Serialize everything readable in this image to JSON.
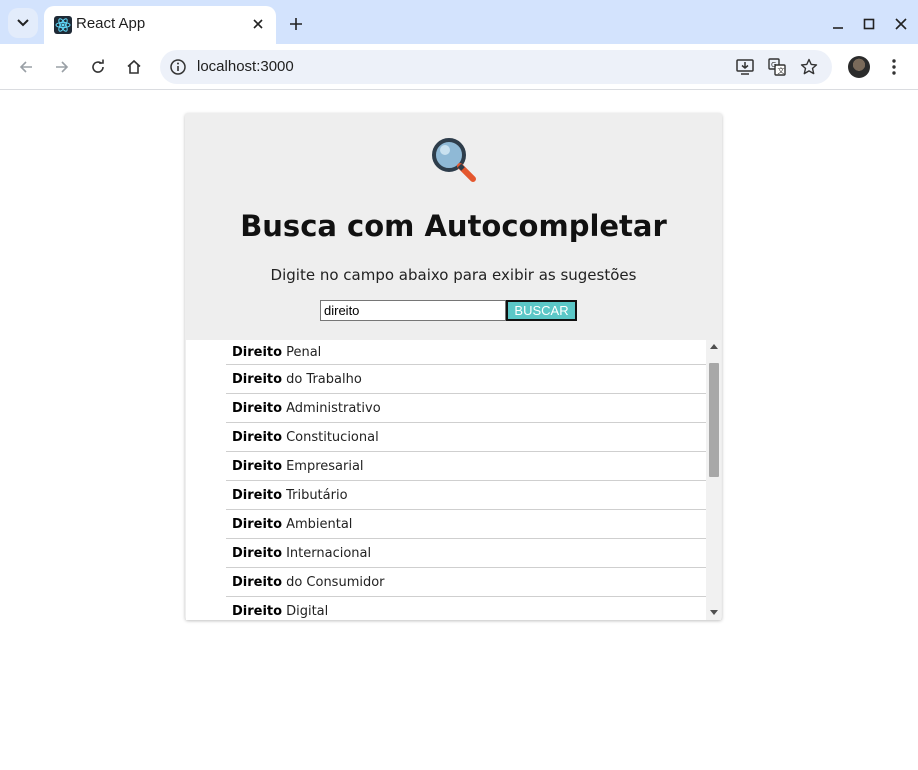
{
  "browser": {
    "tab_title": "React App",
    "url": "localhost:3000",
    "icons": {
      "tab_search": "chevron-down-icon",
      "favicon": "react-icon",
      "tab_close": "close-icon",
      "new_tab": "plus-icon",
      "minimize": "minimize-icon",
      "maximize": "maximize-icon",
      "close_window": "close-icon",
      "back": "arrow-left-icon",
      "forward": "arrow-right-icon",
      "reload": "reload-icon",
      "home": "home-icon",
      "site_info": "info-icon",
      "install": "install-icon",
      "translate": "translate-icon",
      "bookmark": "star-icon",
      "profile": "avatar",
      "menu": "more-vert-icon"
    }
  },
  "page": {
    "title": "Busca com Autocompletar",
    "subtitle": "Digite no campo abaixo para exibir as sugestões",
    "search": {
      "value": "direito",
      "button_label": "BUSCAR"
    },
    "suggestions": [
      {
        "match": "Direito",
        "rest": "Penal"
      },
      {
        "match": "Direito",
        "rest": "do Trabalho"
      },
      {
        "match": "Direito",
        "rest": "Administrativo"
      },
      {
        "match": "Direito",
        "rest": "Constitucional"
      },
      {
        "match": "Direito",
        "rest": "Empresarial"
      },
      {
        "match": "Direito",
        "rest": "Tributário"
      },
      {
        "match": "Direito",
        "rest": "Ambiental"
      },
      {
        "match": "Direito",
        "rest": "Internacional"
      },
      {
        "match": "Direito",
        "rest": "do Consumidor"
      },
      {
        "match": "Direito",
        "rest": "Digital"
      }
    ],
    "colors": {
      "card_bg": "#eeeeee",
      "button_bg": "#5bc7c7",
      "tab_strip": "#d3e3fd"
    }
  }
}
